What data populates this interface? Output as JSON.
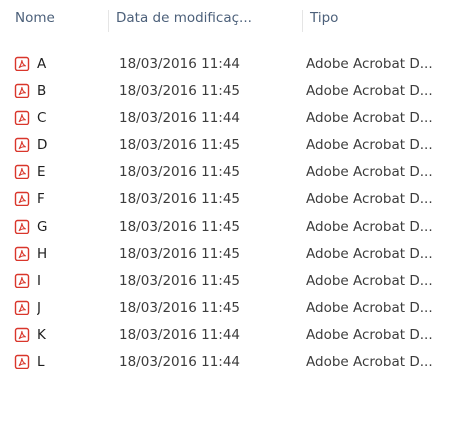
{
  "columns": {
    "name": "Nome",
    "date": "Data de modificaç...",
    "type": "Tipo"
  },
  "icon": "pdf-file-icon",
  "accent_color": "#d9362b",
  "files": [
    {
      "name": "A",
      "date": "18/03/2016 11:44",
      "type": "Adobe Acrobat D..."
    },
    {
      "name": "B",
      "date": "18/03/2016 11:45",
      "type": "Adobe Acrobat D..."
    },
    {
      "name": "C",
      "date": "18/03/2016 11:44",
      "type": "Adobe Acrobat D..."
    },
    {
      "name": "D",
      "date": "18/03/2016 11:45",
      "type": "Adobe Acrobat D..."
    },
    {
      "name": "E",
      "date": "18/03/2016 11:45",
      "type": "Adobe Acrobat D..."
    },
    {
      "name": "F",
      "date": "18/03/2016 11:45",
      "type": "Adobe Acrobat D..."
    },
    {
      "name": "G",
      "date": "18/03/2016 11:45",
      "type": "Adobe Acrobat D..."
    },
    {
      "name": "H",
      "date": "18/03/2016 11:45",
      "type": "Adobe Acrobat D..."
    },
    {
      "name": "I",
      "date": "18/03/2016 11:45",
      "type": "Adobe Acrobat D..."
    },
    {
      "name": "J",
      "date": "18/03/2016 11:45",
      "type": "Adobe Acrobat D..."
    },
    {
      "name": "K",
      "date": "18/03/2016 11:44",
      "type": "Adobe Acrobat D..."
    },
    {
      "name": "L",
      "date": "18/03/2016 11:44",
      "type": "Adobe Acrobat D..."
    }
  ]
}
